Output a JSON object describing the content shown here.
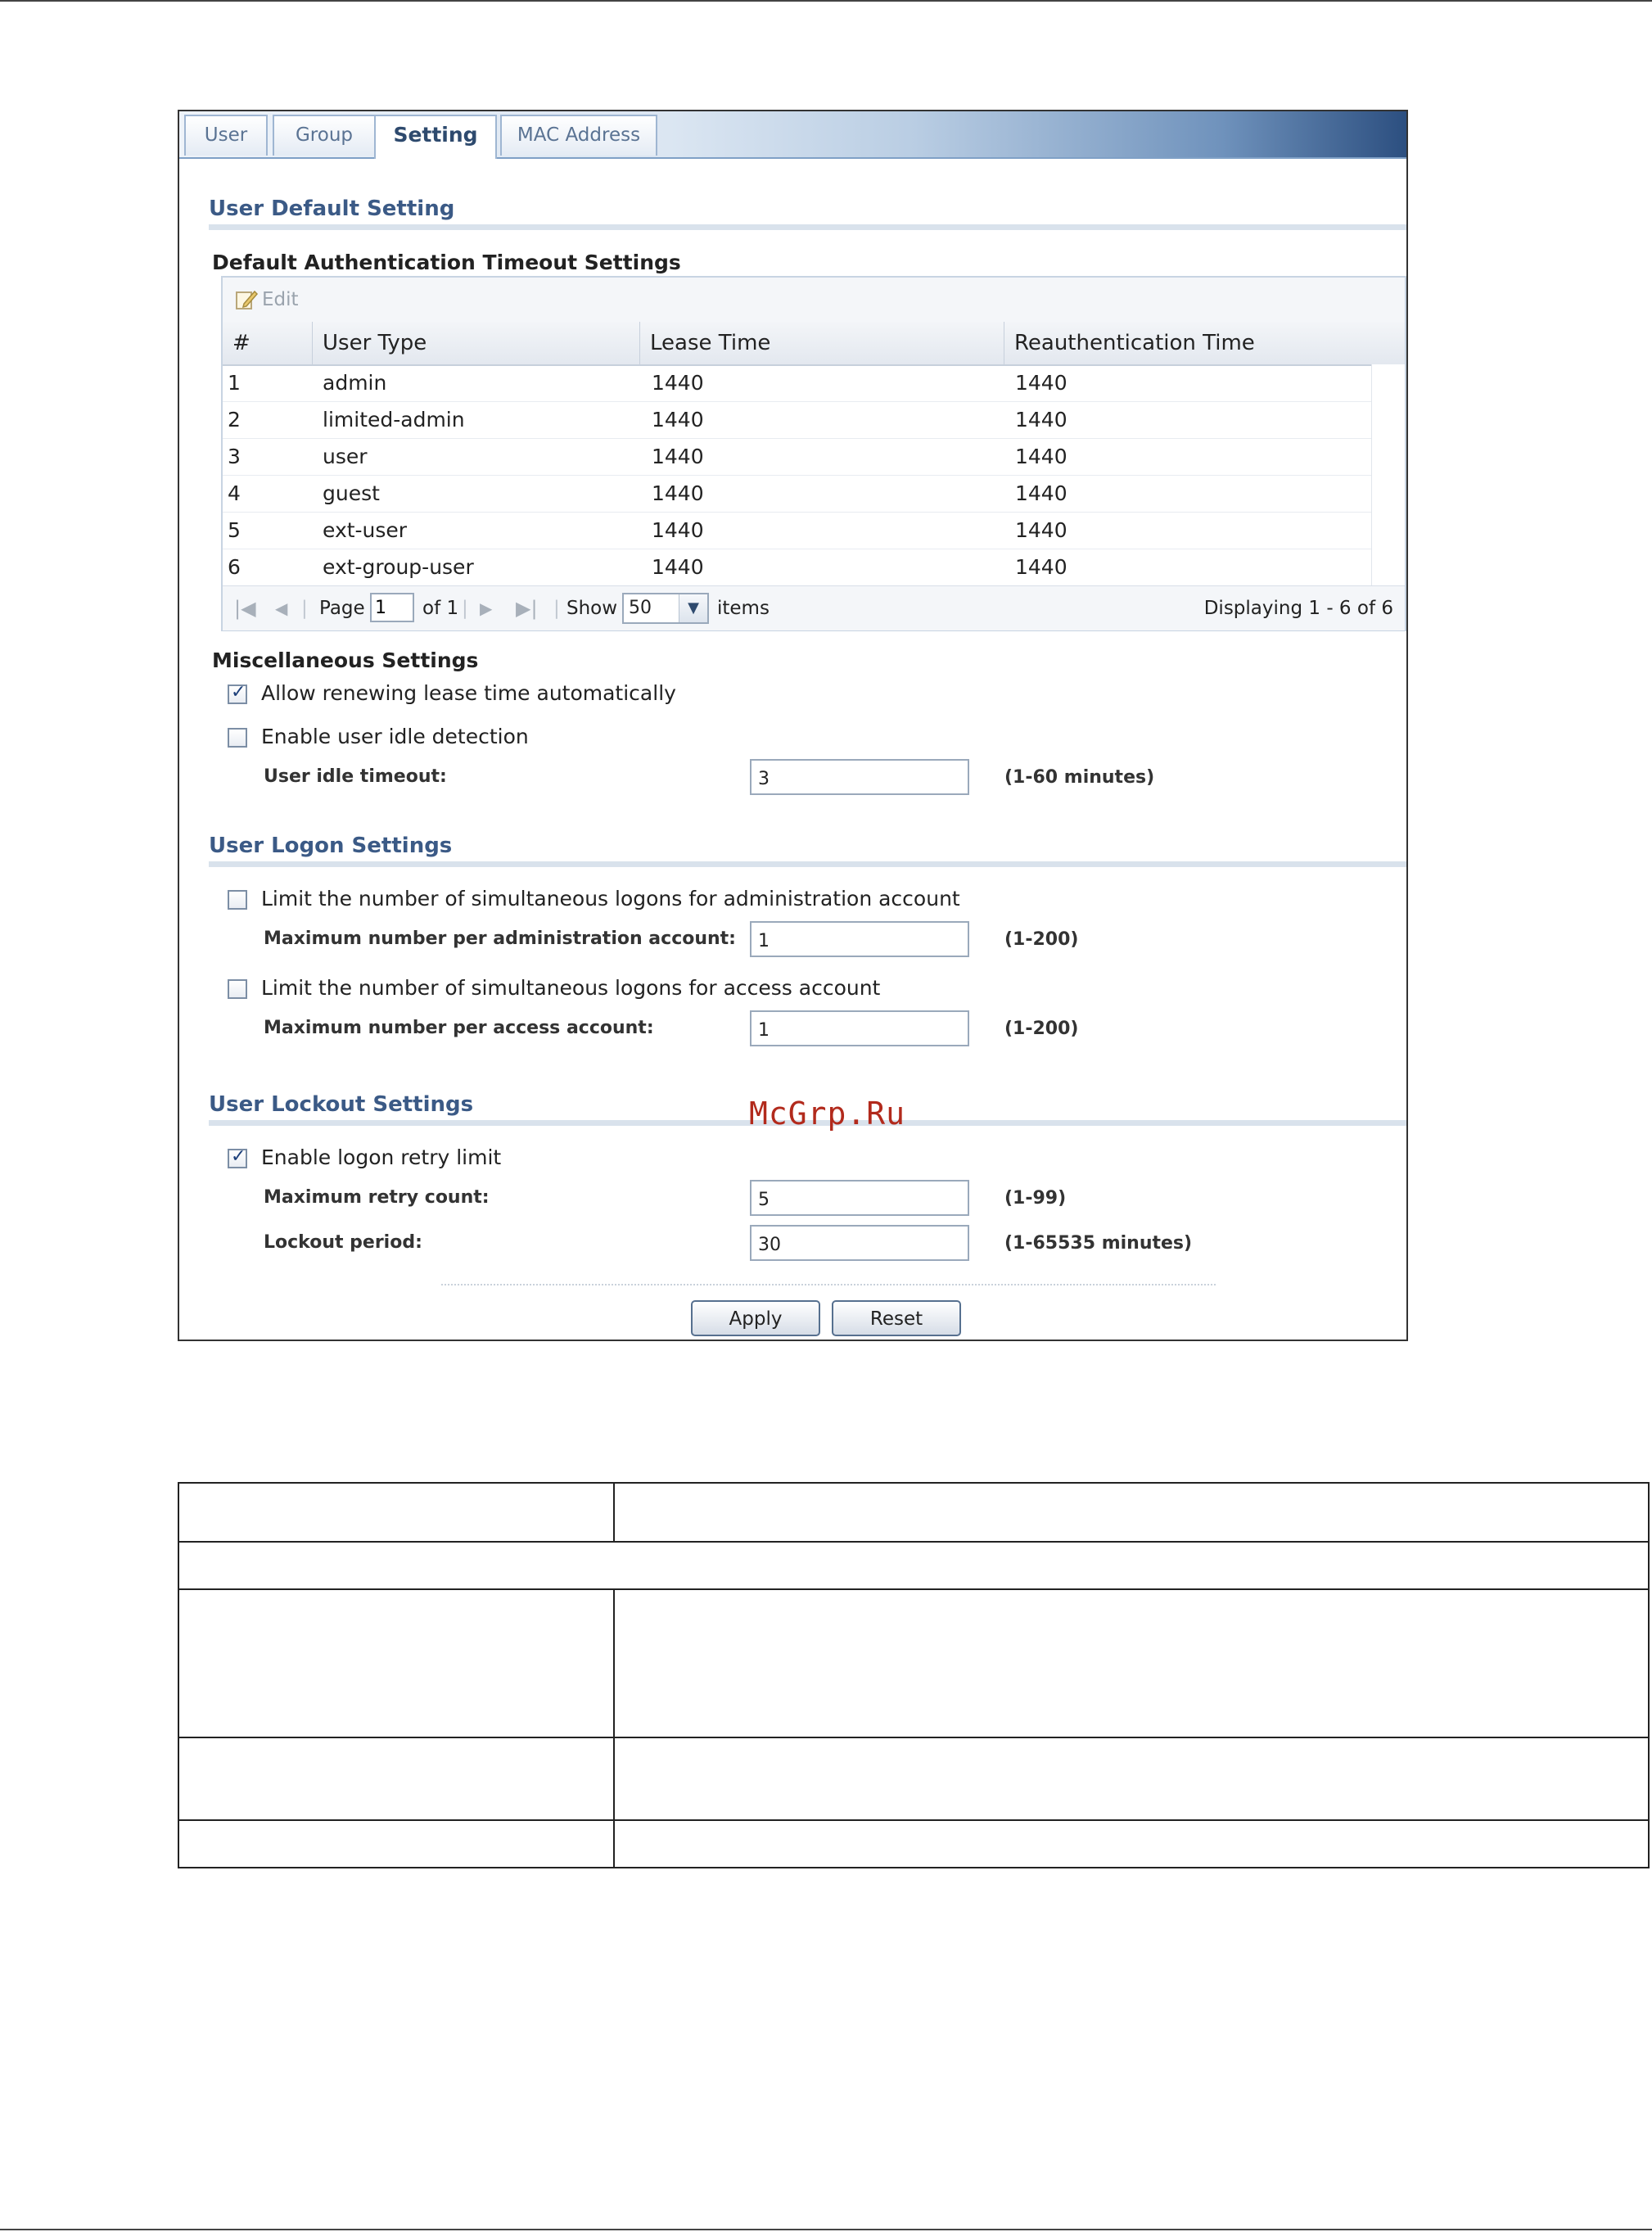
{
  "tabs": [
    {
      "label": "User",
      "active": false
    },
    {
      "label": "Group",
      "active": false
    },
    {
      "label": "Setting",
      "active": true
    },
    {
      "label": "MAC Address",
      "active": false
    }
  ],
  "user_default": {
    "title": "User Default Setting",
    "timeout_title": "Default Authentication Timeout Settings",
    "edit_label": "Edit",
    "columns": [
      "#",
      "User Type",
      "Lease Time",
      "Reauthentication Time"
    ],
    "rows": [
      {
        "num": "1",
        "type": "admin",
        "lease": "1440",
        "reauth": "1440"
      },
      {
        "num": "2",
        "type": "limited-admin",
        "lease": "1440",
        "reauth": "1440"
      },
      {
        "num": "3",
        "type": "user",
        "lease": "1440",
        "reauth": "1440"
      },
      {
        "num": "4",
        "type": "guest",
        "lease": "1440",
        "reauth": "1440"
      },
      {
        "num": "5",
        "type": "ext-user",
        "lease": "1440",
        "reauth": "1440"
      },
      {
        "num": "6",
        "type": "ext-group-user",
        "lease": "1440",
        "reauth": "1440"
      }
    ],
    "pager": {
      "page_label": "Page",
      "page_value": "1",
      "of_label": "of 1",
      "show_label": "Show",
      "show_value": "50",
      "items_label": "items",
      "displaying": "Displaying 1 - 6 of 6"
    }
  },
  "misc": {
    "title": "Miscellaneous Settings",
    "renew_label": "Allow renewing lease time automatically",
    "renew_checked": true,
    "idle_label": "Enable user idle detection",
    "idle_checked": false,
    "idle_timeout_label": "User idle timeout:",
    "idle_timeout_value": "3",
    "idle_timeout_hint": "(1-60 minutes)"
  },
  "logon": {
    "title": "User Logon Settings",
    "admin_limit_label": "Limit the number of simultaneous logons for administration account",
    "admin_limit_checked": false,
    "admin_max_label": "Maximum number per administration account:",
    "admin_max_value": "1",
    "admin_max_hint": "(1-200)",
    "access_limit_label": "Limit the number of simultaneous logons for access account",
    "access_limit_checked": false,
    "access_max_label": "Maximum number per access account:",
    "access_max_value": "1",
    "access_max_hint": "(1-200)"
  },
  "lockout": {
    "title": "User Lockout Settings",
    "retry_label": "Enable logon retry limit",
    "retry_checked": true,
    "max_retry_label": "Maximum retry count:",
    "max_retry_value": "5",
    "max_retry_hint": "(1-99)",
    "period_label": "Lockout period:",
    "period_value": "30",
    "period_hint": "(1-65535 minutes)"
  },
  "buttons": {
    "apply": "Apply",
    "reset": "Reset"
  },
  "watermark": "McGrp.Ru"
}
